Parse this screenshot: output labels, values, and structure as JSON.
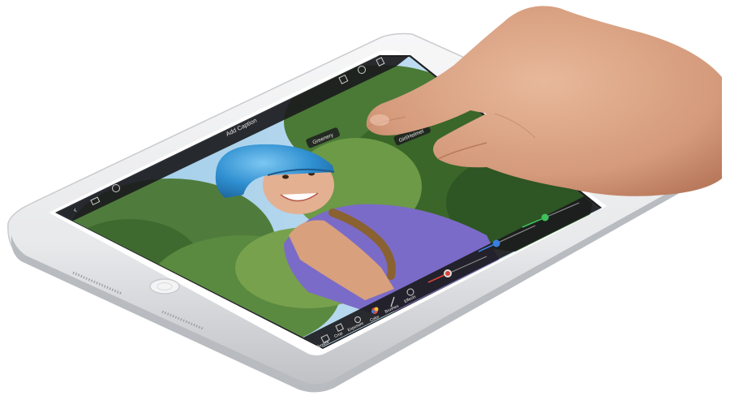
{
  "toolbar": {
    "caption_label": "Add Caption",
    "buttons": [
      "Browse",
      "Crop",
      "Exposure",
      "Color",
      "Brushes",
      "Effects"
    ]
  },
  "photo": {
    "tags": [
      "Greenery",
      "Girl/Helmet"
    ]
  },
  "colors": {
    "device_silver": "#e9eaec",
    "device_bezel": "#ffffff",
    "screen_chrome": "#1f1f21",
    "helmet_blue": "#3aa0dc",
    "shirt_purple": "#7b6bc8",
    "sky_blue": "#8cc6ee",
    "foliage_green": "#4d7a3a",
    "slider_green": "#3fc05a",
    "slider_blue": "#3a7fe0",
    "slider_red": "#d8423a"
  },
  "icons": [
    "back-arrow-icon",
    "grid-icon",
    "help-icon",
    "share-icon",
    "info-icon",
    "trash-icon",
    "browse-icon",
    "crop-icon",
    "exposure-icon",
    "color-wheel-icon",
    "brush-icon",
    "effects-icon",
    "home-button-icon"
  ]
}
